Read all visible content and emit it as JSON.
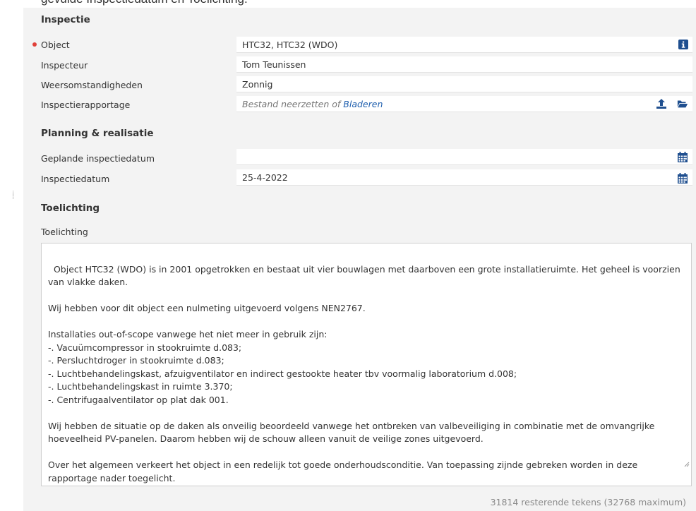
{
  "caption": "gevulde Inspectiedatum en  Toelichting.",
  "sections": {
    "inspectie": "Inspectie",
    "planning": "Planning & realisatie",
    "toelichting": "Toelichting"
  },
  "fields": {
    "object": {
      "label": "Object",
      "value": "HTC32, HTC32 (WDO)"
    },
    "inspecteur": {
      "label": "Inspecteur",
      "value": "Tom Teunissen"
    },
    "weer": {
      "label": "Weersomstandigheden",
      "value": "Zonnig"
    },
    "rapportage": {
      "label": "Inspectierapportage",
      "placeholder": "Bestand neerzetten of ",
      "link": "Bladeren"
    },
    "gepland": {
      "label": "Geplande inspectiedatum",
      "value": ""
    },
    "datum": {
      "label": "Inspectiedatum",
      "value": "25-4-2022"
    },
    "toelichting": {
      "label": "Toelichting",
      "text": "Object HTC32 (WDO) is in 2001 opgetrokken en bestaat uit vier bouwlagen met daarboven een grote installatieruimte. Het geheel is voorzien\nvan vlakke daken.\n\nWij hebben voor dit object een nulmeting uitgevoerd volgens NEN2767.\n\nInstallaties out-of-scope vanwege het niet meer in gebruik zijn:\n-. Vacuümcompressor in stookruimte d.083;\n-. Persluchtdroger in stookruimte d.083;\n-. Luchtbehandelingskast, afzuigventilator en indirect gestookte heater tbv voormalig laboratorium d.008;\n-. Luchtbehandelingskast in ruimte 3.370;\n-. Centrifugaalventilator op plat dak 001.\n\nWij hebben de situatie op de daken als onveilig beoordeeld vanwege het ontbreken van valbeveiliging in combinatie met de omvangrijke\nhoeveelheid PV-panelen. Daarom hebben wij de schouw alleen vanuit de veilige zones uitgevoerd.\n\nOver het algemeen verkeert het object in een redelijk tot goede onderhoudsconditie. Van toepassing zijnde gebreken worden in deze\nrapportage nader toegelicht.",
      "counter": "31814 resterende tekens (32768 maximum)"
    }
  },
  "icons": {
    "info": "info-icon",
    "upload": "upload-icon",
    "folder": "folder-open-icon",
    "calendar": "calendar-icon"
  },
  "colors": {
    "required": "#e0403a",
    "icon": "#1f4f8f",
    "link": "#1f5fae"
  }
}
